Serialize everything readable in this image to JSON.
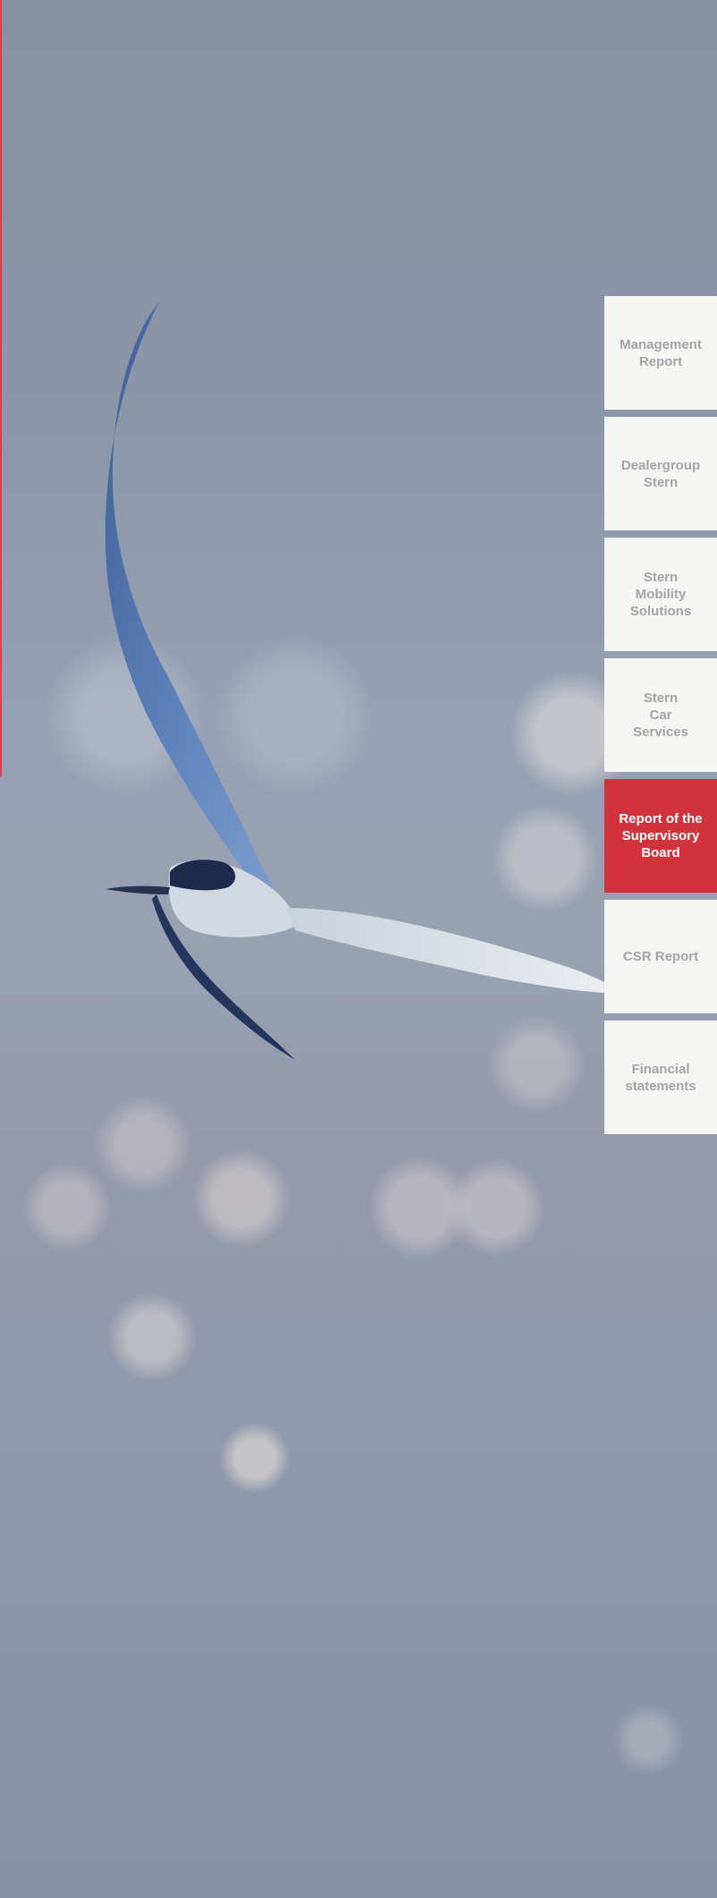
{
  "page": {
    "accent_color": "#d8404c",
    "nav_active_color": "#d2323c",
    "nav_bg_color": "#f5f5f3",
    "nav_text_color": "#a4a4a4"
  },
  "hero": {
    "image_subject": "tern-in-flight-photo"
  },
  "nav": {
    "items": [
      {
        "label": "Management\nReport",
        "active": false
      },
      {
        "label": "Dealergroup\nStern",
        "active": false
      },
      {
        "label": "Stern\nMobility\nSolutions",
        "active": false
      },
      {
        "label": "Stern\nCar\nServices",
        "active": false
      },
      {
        "label": "Report of the\nSupervisory\nBoard",
        "active": true
      },
      {
        "label": "CSR Report",
        "active": false
      },
      {
        "label": "Financial\nstatements",
        "active": false
      }
    ]
  }
}
